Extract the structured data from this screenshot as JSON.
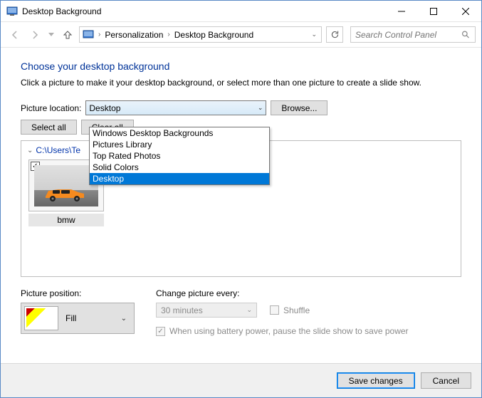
{
  "window": {
    "title": "Desktop Background"
  },
  "breadcrumb": {
    "item1": "Personalization",
    "item2": "Desktop Background"
  },
  "search": {
    "placeholder": "Search Control Panel"
  },
  "heading": "Choose your desktop background",
  "subtitle": "Click a picture to make it your desktop background, or select more than one picture to create a slide show.",
  "picture_location": {
    "label": "Picture location:",
    "value": "Desktop",
    "options": [
      "Windows Desktop Backgrounds",
      "Pictures Library",
      "Top Rated Photos",
      "Solid Colors",
      "Desktop"
    ]
  },
  "browse_label": "Browse...",
  "select_all_label": "Select all",
  "clear_all_label": "Clear all",
  "group_path": "C:\\Users\\Te",
  "thumb": {
    "name": "bmw"
  },
  "picture_position": {
    "label": "Picture position:",
    "value": "Fill"
  },
  "change_every": {
    "label": "Change picture every:",
    "value": "30 minutes"
  },
  "shuffle_label": "Shuffle",
  "battery_label": "When using battery power, pause the slide show to save power",
  "footer": {
    "save": "Save changes",
    "cancel": "Cancel"
  }
}
